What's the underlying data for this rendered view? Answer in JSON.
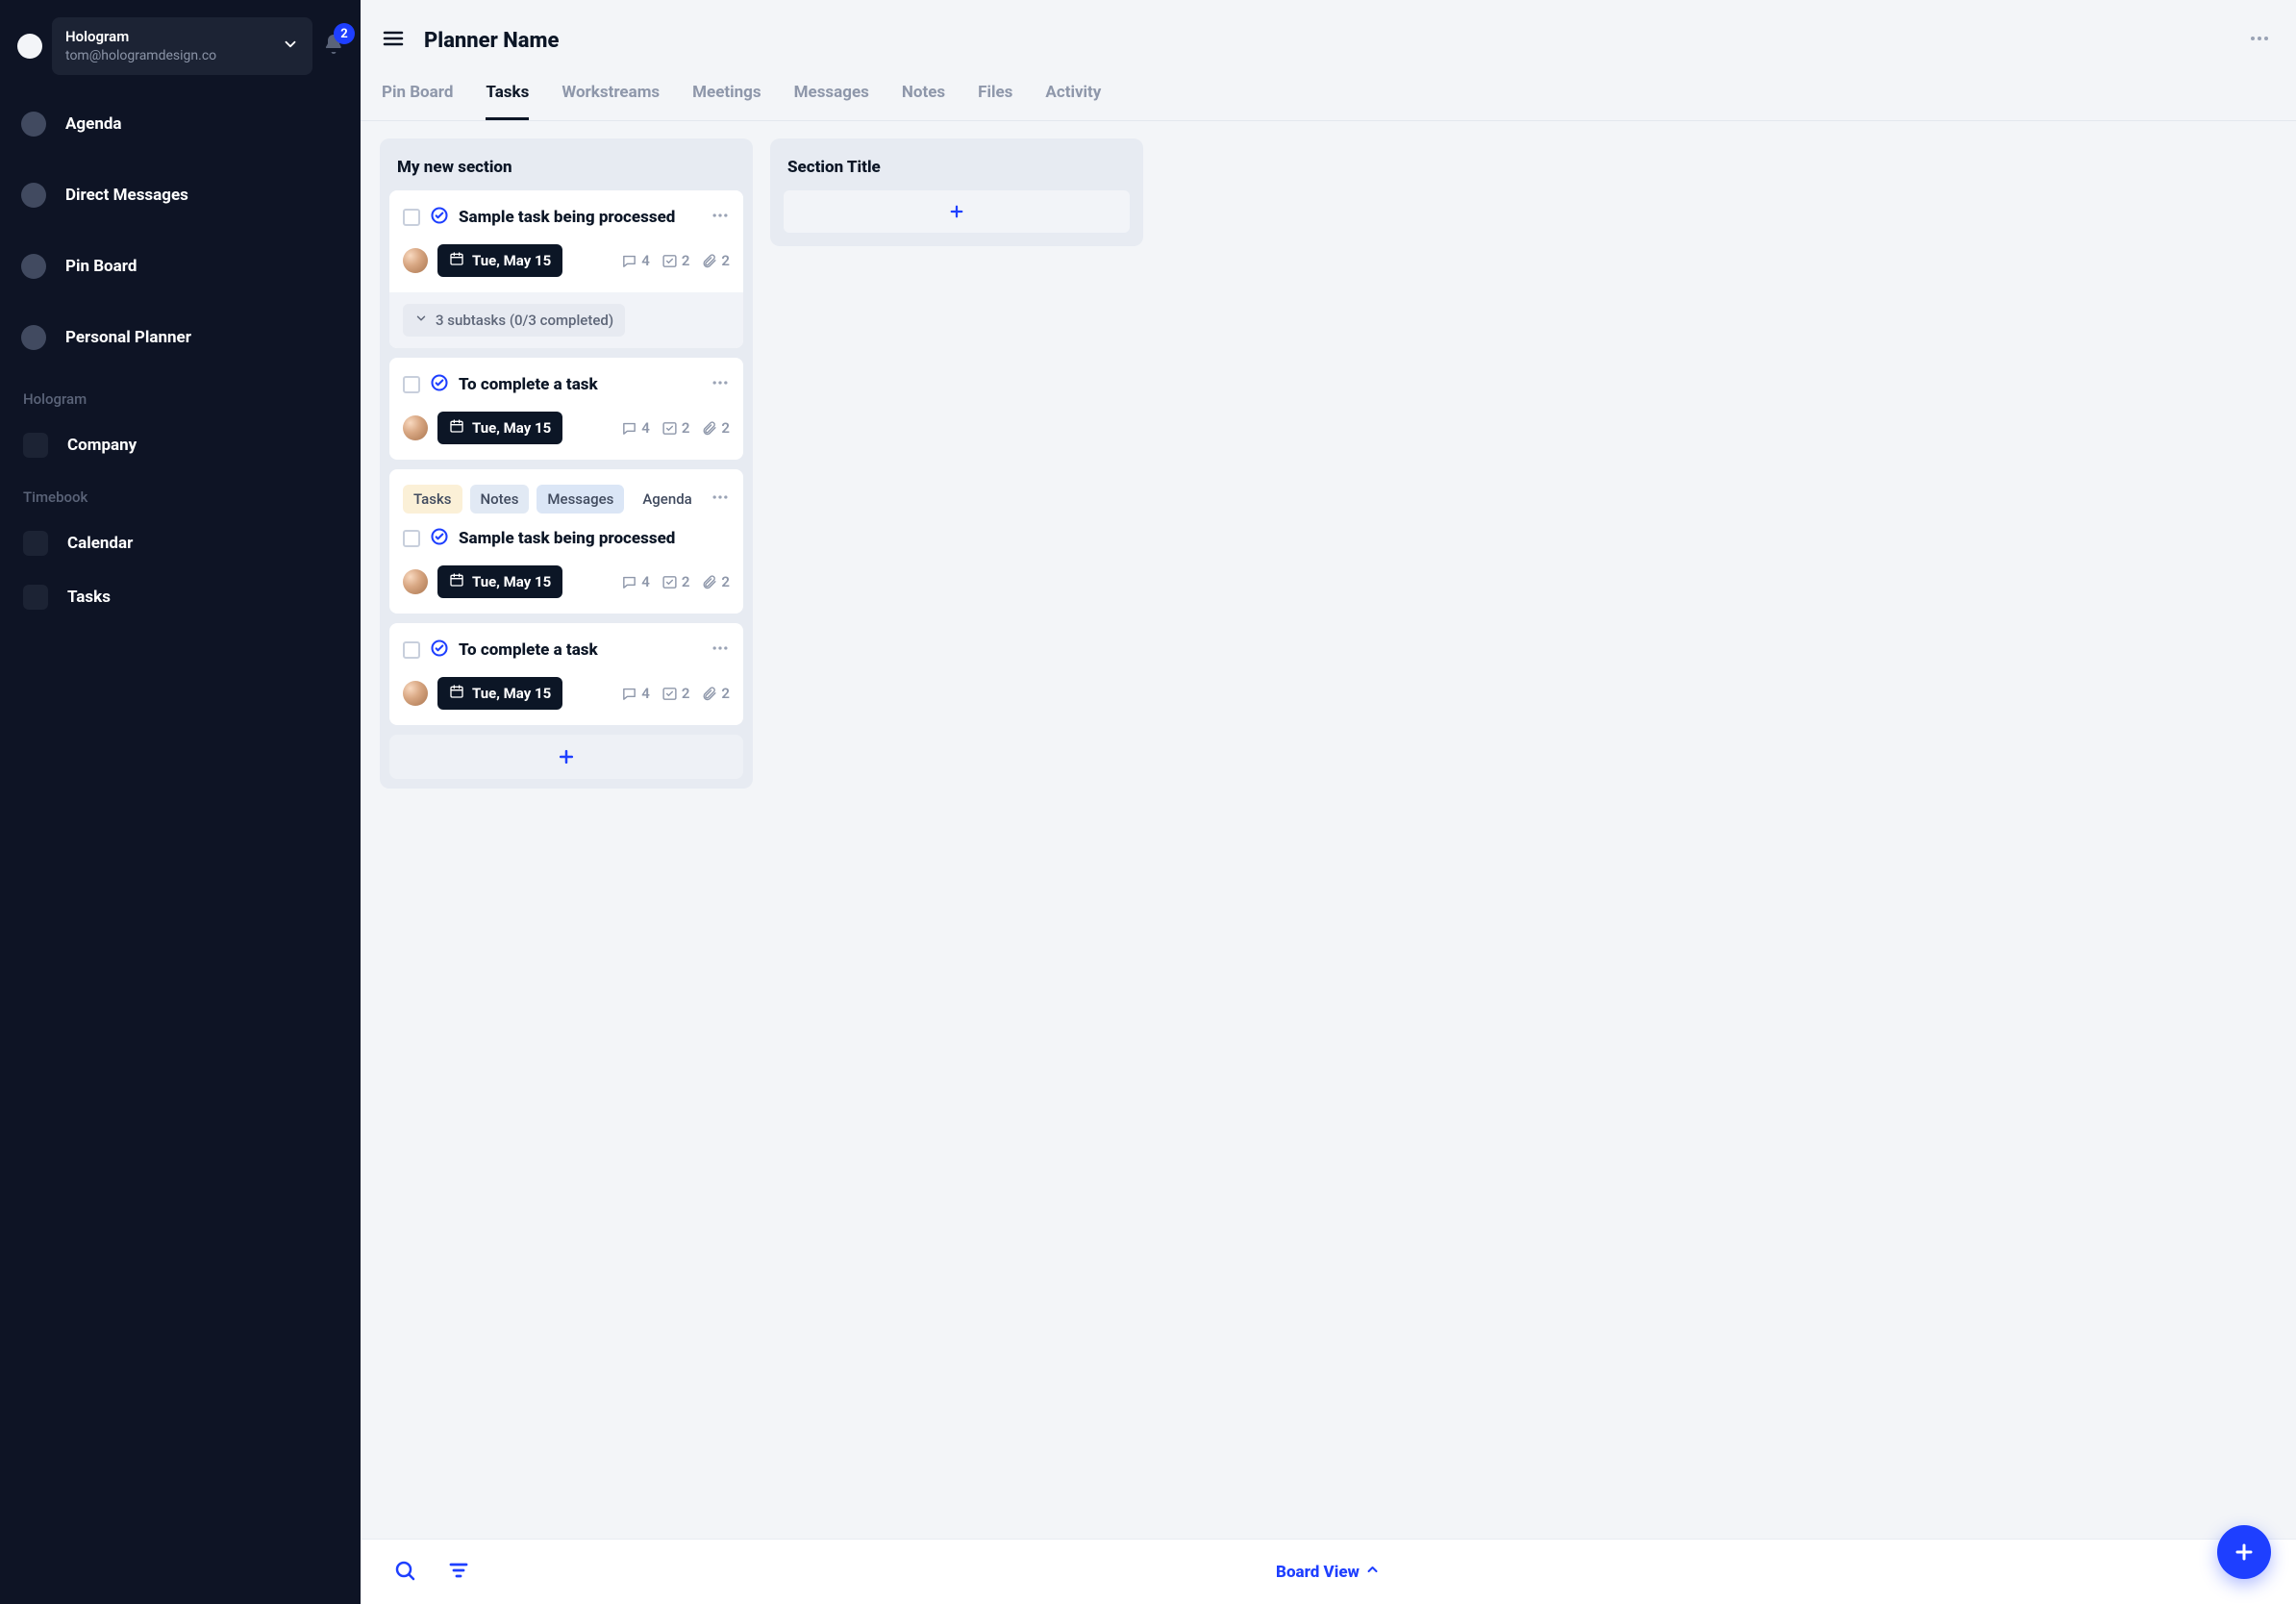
{
  "workspace": {
    "name": "Hologram",
    "email": "tom@hologramdesign.co",
    "notification_count": "2"
  },
  "sidebar": {
    "items": [
      {
        "label": "Agenda"
      },
      {
        "label": "Direct Messages"
      },
      {
        "label": "Pin Board"
      },
      {
        "label": "Personal Planner"
      }
    ],
    "groups": [
      {
        "header": "Hologram",
        "items": [
          {
            "label": "Company"
          }
        ]
      },
      {
        "header": "Timebook",
        "items": [
          {
            "label": "Calendar"
          },
          {
            "label": "Tasks"
          }
        ]
      }
    ]
  },
  "header": {
    "title": "Planner Name",
    "tabs": [
      {
        "label": "Pin Board"
      },
      {
        "label": "Tasks"
      },
      {
        "label": "Workstreams"
      },
      {
        "label": "Meetings"
      },
      {
        "label": "Messages"
      },
      {
        "label": "Notes"
      },
      {
        "label": "Files"
      },
      {
        "label": "Activity"
      }
    ],
    "active_tab": "Tasks"
  },
  "board": {
    "columns": [
      {
        "title": "My new section",
        "cards": [
          {
            "title": "Sample task being processed",
            "date": "Tue, May 15",
            "comments": "4",
            "checks": "2",
            "attachments": "2",
            "subtasks": "3 subtasks (0/3 completed)"
          },
          {
            "title": "To complete a task",
            "date": "Tue, May 15",
            "comments": "4",
            "checks": "2",
            "attachments": "2"
          },
          {
            "tags": [
              "Tasks",
              "Notes",
              "Messages",
              "Agenda"
            ],
            "title": "Sample task being processed",
            "date": "Tue, May 15",
            "comments": "4",
            "checks": "2",
            "attachments": "2"
          },
          {
            "title": "To complete a task",
            "date": "Tue, May 15",
            "comments": "4",
            "checks": "2",
            "attachments": "2"
          }
        ]
      },
      {
        "title": "Section Title"
      }
    ]
  },
  "bottombar": {
    "view_label": "Board View"
  }
}
